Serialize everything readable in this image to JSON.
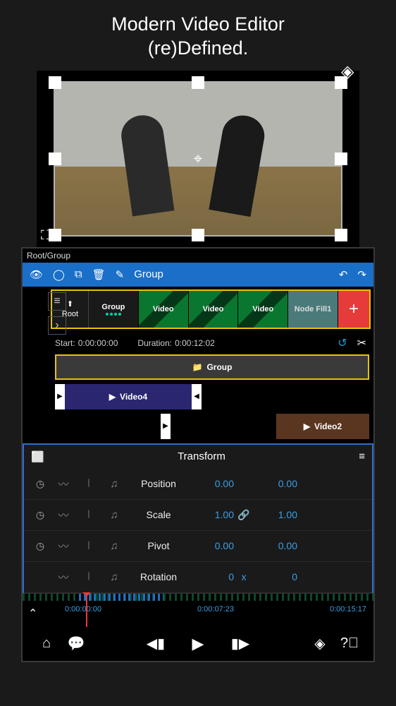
{
  "tagline": {
    "line1": "Modern Video Editor",
    "line2": "(re)Defined."
  },
  "breadcrumb": "Root/Group",
  "toolbar": {
    "group_label": "Group"
  },
  "clips": {
    "root_label": "Root",
    "group_label": "Group",
    "video1": "Video",
    "video2": "Video",
    "video3": "Video",
    "nodefill": "Node Fill1"
  },
  "time": {
    "start_label": "Start:",
    "start_value": "0:00:00:00",
    "duration_label": "Duration:",
    "duration_value": "0:00:12:02"
  },
  "tracks": {
    "group": "Group",
    "video4": "Video4",
    "video2": "Video2"
  },
  "transform": {
    "title": "Transform",
    "rows": [
      {
        "label": "Position",
        "v1": "0.00",
        "link": "",
        "v2": "0.00"
      },
      {
        "label": "Scale",
        "v1": "1.00",
        "link": "🔗",
        "v2": "1.00"
      },
      {
        "label": "Pivot",
        "v1": "0.00",
        "link": "",
        "v2": "0.00"
      },
      {
        "label": "Rotation",
        "v1": "0",
        "link": "x",
        "v2": "0"
      }
    ]
  },
  "ruler": {
    "t1": "0:00:00:00",
    "t2": "0:00:07:23",
    "t3": "0:00:15:17"
  }
}
